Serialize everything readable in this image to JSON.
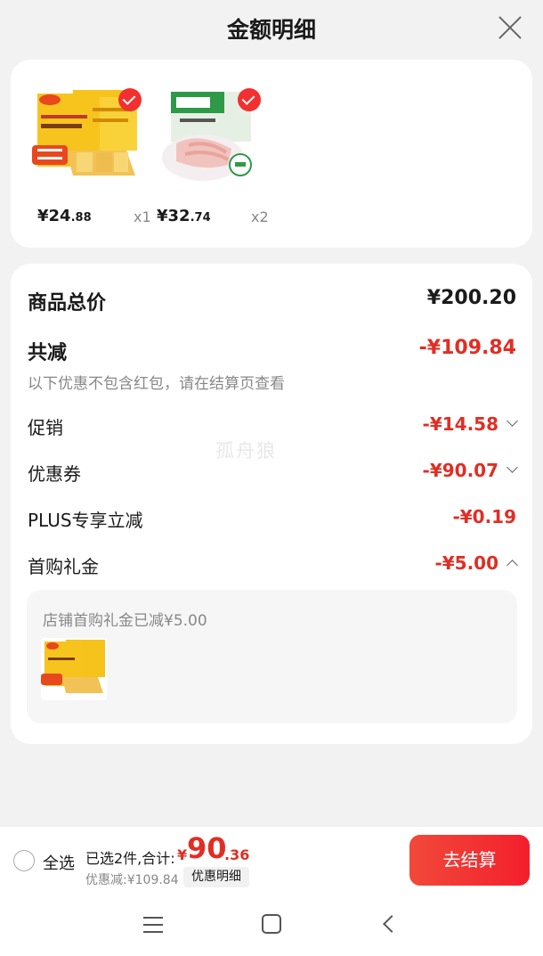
{
  "header": {
    "title": "金额明细"
  },
  "products": [
    {
      "price_symbol": "¥",
      "price_int": "24",
      "price_dec": ".88",
      "qty": "x1",
      "image": "pancake-pack-product"
    },
    {
      "price_symbol": "¥",
      "price_int": "32",
      "price_dec": ".74",
      "qty": "x2",
      "image": "chicken-feet-pack-product"
    }
  ],
  "summary": {
    "total_label": "商品总价",
    "total_value": "¥200.20",
    "reduce_label": "共减",
    "reduce_value": "-¥109.84",
    "note": "以下优惠不包含红包，请在结算页查看",
    "items": [
      {
        "label": "促销",
        "value": "-¥14.58",
        "chevron": "down"
      },
      {
        "label": "优惠券",
        "value": "-¥90.07",
        "chevron": "down"
      },
      {
        "label": "PLUS专享立减",
        "value": "-¥0.19",
        "chevron": "none"
      },
      {
        "label": "首购礼金",
        "value": "-¥5.00",
        "chevron": "up"
      }
    ],
    "gift_note": "店铺首购礼金已减¥5.00"
  },
  "watermark": "孤舟狼",
  "bottom": {
    "select_all": "全选",
    "selected_info": "已选2件,合计:",
    "sum_symbol": "¥",
    "sum_int": "90",
    "sum_dec": ".36",
    "discount_info": "优惠减:¥109.84",
    "detail_tag": "优惠明细",
    "checkout": "去结算"
  },
  "colors": {
    "accent": "#e02e24",
    "button": "#f31f2c"
  }
}
